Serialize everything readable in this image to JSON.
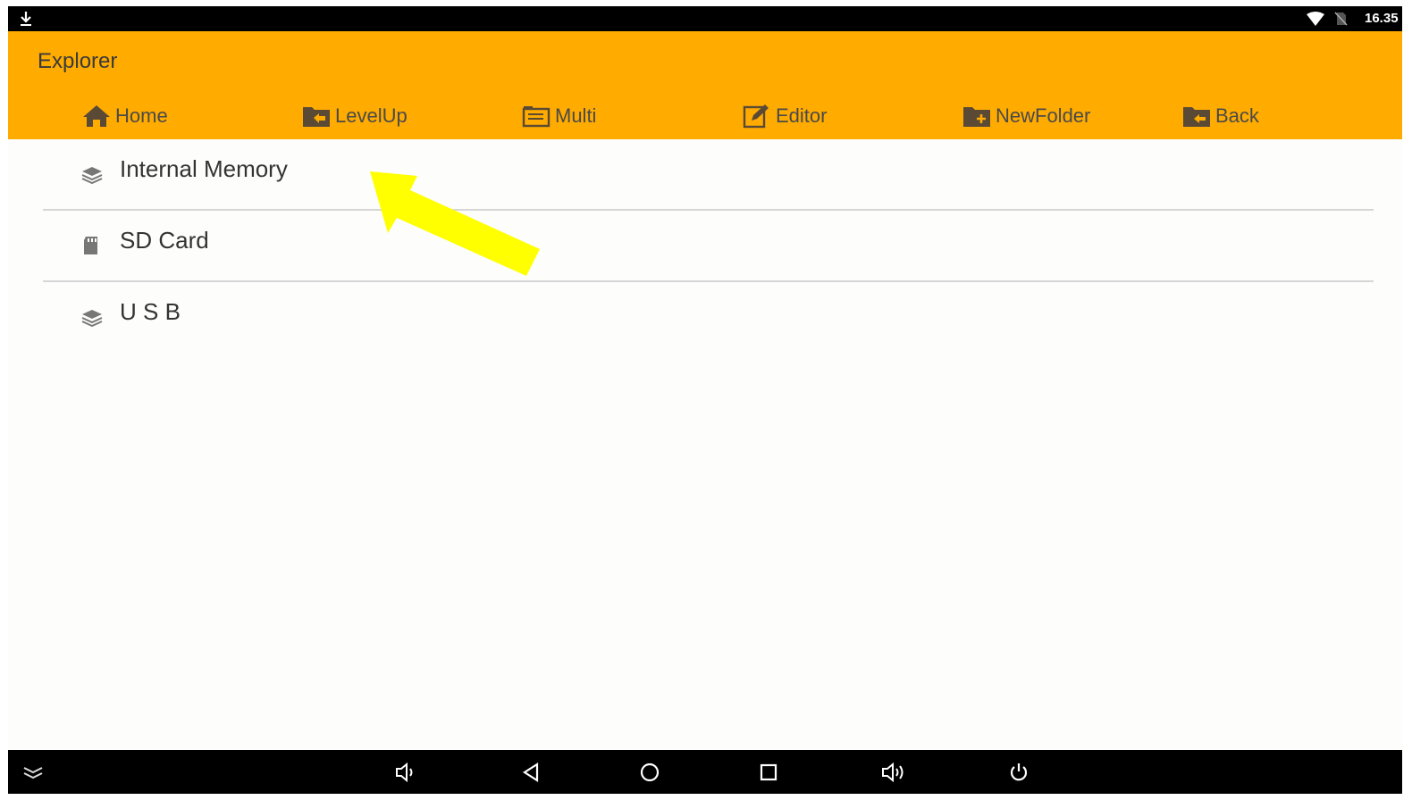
{
  "status_bar": {
    "time": "16.35",
    "icons": [
      "download-icon",
      "wifi-icon",
      "no-sim-icon"
    ]
  },
  "app_bar": {
    "title": "Explorer",
    "background_color": "#ffab00",
    "toolbar": [
      {
        "label": "Home",
        "icon": "home-icon"
      },
      {
        "label": "LevelUp",
        "icon": "folder-levelup-icon"
      },
      {
        "label": "Multi",
        "icon": "multi-select-icon"
      },
      {
        "label": "Editor",
        "icon": "edit-icon"
      },
      {
        "label": "NewFolder",
        "icon": "new-folder-icon"
      },
      {
        "label": "Back",
        "icon": "folder-back-icon"
      }
    ]
  },
  "storage_list": [
    {
      "label": "Internal Memory",
      "icon": "storage-stack-icon"
    },
    {
      "label": "SD Card",
      "icon": "sd-card-icon"
    },
    {
      "label": "U S B",
      "icon": "storage-stack-icon"
    }
  ],
  "annotation": {
    "icon": "pointer-arrow",
    "color": "#ffff00"
  },
  "nav_bar": {
    "buttons": [
      "collapse-icon",
      "volume-down-icon",
      "back-icon",
      "home-icon",
      "recents-icon",
      "volume-up-icon",
      "power-icon"
    ]
  }
}
